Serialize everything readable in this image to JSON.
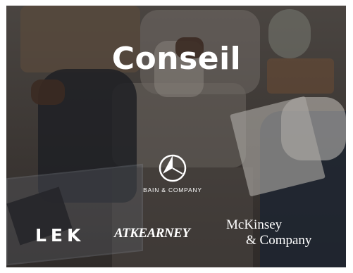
{
  "slide": {
    "title": "Conseil",
    "logos": {
      "bain": "BAIN & COMPANY",
      "lek": "LEK",
      "atkearney": "ATKEARNEY",
      "mckinsey_line1": "McKinsey",
      "mckinsey_line2": "& Company"
    }
  },
  "colors": {
    "overlay": "#3a3532",
    "text": "#ffffff"
  }
}
